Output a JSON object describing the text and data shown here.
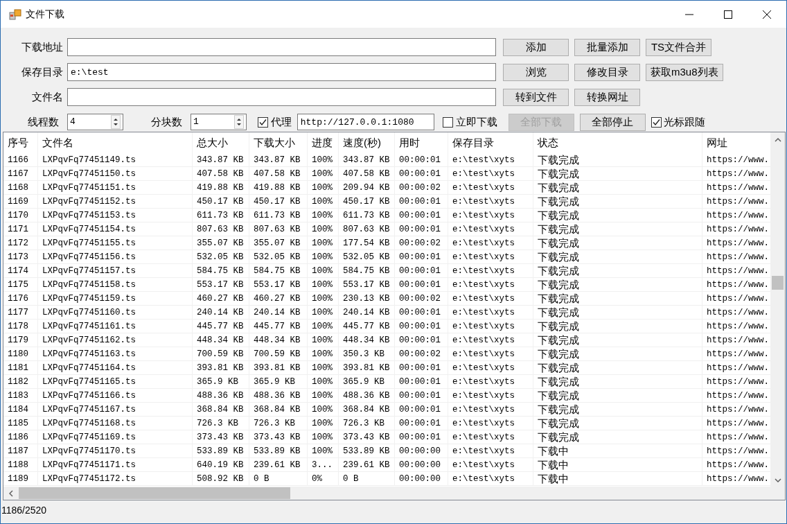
{
  "window": {
    "title": "文件下载"
  },
  "form": {
    "url": {
      "label": "下载地址"
    },
    "save_dir": {
      "label": "保存目录",
      "value": "e:\\test"
    },
    "file_name": {
      "label": "文件名"
    },
    "threads": {
      "label": "线程数",
      "value": "4"
    },
    "chunks": {
      "label": "分块数",
      "value": "1"
    },
    "proxy": {
      "label": "代理",
      "checked": true,
      "value": "http://127.0.0.1:1080"
    },
    "download_now": {
      "label": "立即下载",
      "checked": false
    },
    "follow_cursor": {
      "label": "光标跟随",
      "checked": true
    }
  },
  "buttons": [
    {
      "label": "添加",
      "disabled": false
    },
    {
      "label": "批量添加",
      "disabled": false
    },
    {
      "label": "TS文件合并",
      "disabled": false
    },
    {
      "label": "浏览",
      "disabled": false
    },
    {
      "label": "修改目录",
      "disabled": false
    },
    {
      "label": "获取m3u8列表",
      "disabled": false
    },
    {
      "label": "转到文件",
      "disabled": false
    },
    {
      "label": "转换网址",
      "disabled": false
    },
    {
      "label": "全部下载",
      "disabled": true
    },
    {
      "label": "全部停止",
      "disabled": false
    }
  ],
  "table": {
    "columns": [
      "序号",
      "文件名",
      "总大小",
      "下载大小",
      "进度",
      "速度(秒)",
      "用时",
      "保存目录",
      "状态",
      "网址"
    ],
    "rows": [
      [
        "1166",
        "LXPqvFq77451149.ts",
        "343.87 KB",
        "343.87 KB",
        "100%",
        "343.87 KB",
        "00:00:01",
        "e:\\test\\xyts",
        "下载完成",
        "https://www."
      ],
      [
        "1167",
        "LXPqvFq77451150.ts",
        "407.58 KB",
        "407.58 KB",
        "100%",
        "407.58 KB",
        "00:00:01",
        "e:\\test\\xyts",
        "下载完成",
        "https://www."
      ],
      [
        "1168",
        "LXPqvFq77451151.ts",
        "419.88 KB",
        "419.88 KB",
        "100%",
        "209.94 KB",
        "00:00:02",
        "e:\\test\\xyts",
        "下载完成",
        "https://www."
      ],
      [
        "1169",
        "LXPqvFq77451152.ts",
        "450.17 KB",
        "450.17 KB",
        "100%",
        "450.17 KB",
        "00:00:01",
        "e:\\test\\xyts",
        "下载完成",
        "https://www."
      ],
      [
        "1170",
        "LXPqvFq77451153.ts",
        "611.73 KB",
        "611.73 KB",
        "100%",
        "611.73 KB",
        "00:00:01",
        "e:\\test\\xyts",
        "下载完成",
        "https://www."
      ],
      [
        "1171",
        "LXPqvFq77451154.ts",
        "807.63 KB",
        "807.63 KB",
        "100%",
        "807.63 KB",
        "00:00:01",
        "e:\\test\\xyts",
        "下载完成",
        "https://www."
      ],
      [
        "1172",
        "LXPqvFq77451155.ts",
        "355.07 KB",
        "355.07 KB",
        "100%",
        "177.54 KB",
        "00:00:02",
        "e:\\test\\xyts",
        "下载完成",
        "https://www."
      ],
      [
        "1173",
        "LXPqvFq77451156.ts",
        "532.05 KB",
        "532.05 KB",
        "100%",
        "532.05 KB",
        "00:00:01",
        "e:\\test\\xyts",
        "下载完成",
        "https://www."
      ],
      [
        "1174",
        "LXPqvFq77451157.ts",
        "584.75 KB",
        "584.75 KB",
        "100%",
        "584.75 KB",
        "00:00:01",
        "e:\\test\\xyts",
        "下载完成",
        "https://www."
      ],
      [
        "1175",
        "LXPqvFq77451158.ts",
        "553.17 KB",
        "553.17 KB",
        "100%",
        "553.17 KB",
        "00:00:01",
        "e:\\test\\xyts",
        "下载完成",
        "https://www."
      ],
      [
        "1176",
        "LXPqvFq77451159.ts",
        "460.27 KB",
        "460.27 KB",
        "100%",
        "230.13 KB",
        "00:00:02",
        "e:\\test\\xyts",
        "下载完成",
        "https://www."
      ],
      [
        "1177",
        "LXPqvFq77451160.ts",
        "240.14 KB",
        "240.14 KB",
        "100%",
        "240.14 KB",
        "00:00:01",
        "e:\\test\\xyts",
        "下载完成",
        "https://www."
      ],
      [
        "1178",
        "LXPqvFq77451161.ts",
        "445.77 KB",
        "445.77 KB",
        "100%",
        "445.77 KB",
        "00:00:01",
        "e:\\test\\xyts",
        "下载完成",
        "https://www."
      ],
      [
        "1179",
        "LXPqvFq77451162.ts",
        "448.34 KB",
        "448.34 KB",
        "100%",
        "448.34 KB",
        "00:00:01",
        "e:\\test\\xyts",
        "下载完成",
        "https://www."
      ],
      [
        "1180",
        "LXPqvFq77451163.ts",
        "700.59 KB",
        "700.59 KB",
        "100%",
        "350.3 KB",
        "00:00:02",
        "e:\\test\\xyts",
        "下载完成",
        "https://www."
      ],
      [
        "1181",
        "LXPqvFq77451164.ts",
        "393.81 KB",
        "393.81 KB",
        "100%",
        "393.81 KB",
        "00:00:01",
        "e:\\test\\xyts",
        "下载完成",
        "https://www."
      ],
      [
        "1182",
        "LXPqvFq77451165.ts",
        "365.9 KB",
        "365.9 KB",
        "100%",
        "365.9 KB",
        "00:00:01",
        "e:\\test\\xyts",
        "下载完成",
        "https://www."
      ],
      [
        "1183",
        "LXPqvFq77451166.ts",
        "488.36 KB",
        "488.36 KB",
        "100%",
        "488.36 KB",
        "00:00:01",
        "e:\\test\\xyts",
        "下载完成",
        "https://www."
      ],
      [
        "1184",
        "LXPqvFq77451167.ts",
        "368.84 KB",
        "368.84 KB",
        "100%",
        "368.84 KB",
        "00:00:01",
        "e:\\test\\xyts",
        "下载完成",
        "https://www."
      ],
      [
        "1185",
        "LXPqvFq77451168.ts",
        "726.3 KB",
        "726.3 KB",
        "100%",
        "726.3 KB",
        "00:00:01",
        "e:\\test\\xyts",
        "下载完成",
        "https://www."
      ],
      [
        "1186",
        "LXPqvFq77451169.ts",
        "373.43 KB",
        "373.43 KB",
        "100%",
        "373.43 KB",
        "00:00:01",
        "e:\\test\\xyts",
        "下载完成",
        "https://www."
      ],
      [
        "1187",
        "LXPqvFq77451170.ts",
        "533.89 KB",
        "533.89 KB",
        "100%",
        "533.89 KB",
        "00:00:00",
        "e:\\test\\xyts",
        "下载中",
        "https://www."
      ],
      [
        "1188",
        "LXPqvFq77451171.ts",
        "640.19 KB",
        "239.61 KB",
        "3...",
        "239.61 KB",
        "00:00:00",
        "e:\\test\\xyts",
        "下载中",
        "https://www."
      ],
      [
        "1189",
        "LXPqvFq77451172.ts",
        "508.92 KB",
        "0 B",
        "0%",
        "0 B",
        "00:00:00",
        "e:\\test\\xyts",
        "下载中",
        "https://www."
      ]
    ]
  },
  "status_bar": "1186/2520"
}
